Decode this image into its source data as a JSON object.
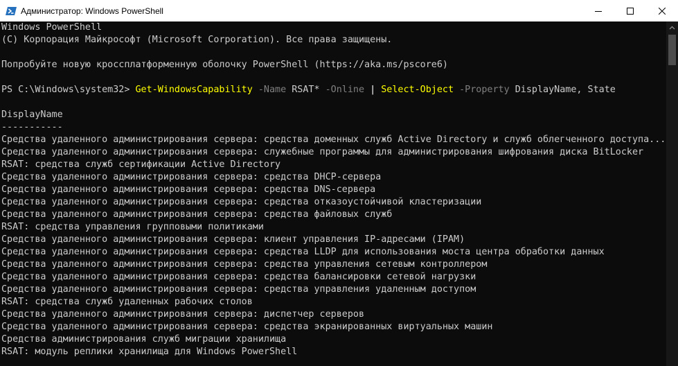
{
  "window": {
    "title": "Администратор: Windows PowerShell",
    "icons": {
      "app": "powershell-icon",
      "minimize": "minimize-icon",
      "maximize": "maximize-icon",
      "close": "close-icon"
    }
  },
  "console": {
    "banner": [
      "Windows PowerShell",
      "(C) Корпорация Майкрософт (Microsoft Corporation). Все права защищены.",
      "",
      "Попробуйте новую кроссплатформенную оболочку PowerShell (https://aka.ms/pscore6)",
      ""
    ],
    "command": {
      "prompt": "PS C:\\Windows\\system32> ",
      "cmdlet1": "Get-WindowsCapability",
      "param1": " -Name",
      "arg1": " RSAT*",
      "param2": " -Online",
      "pipe": " | ",
      "cmdlet2": "Select-Object",
      "param3": " -Property",
      "arg3": " DisplayName, State"
    },
    "output": [
      "",
      "DisplayName",
      "-----------",
      "Средства удаленного администрирования сервера: средства доменных служб Active Directory и служб облегченного доступа...",
      "Средства удаленного администрирования сервера: служебные программы для администрирования шифрования диска BitLocker",
      "RSAT: средства служб сертификации Active Directory",
      "Средства удаленного администрирования сервера: средства DHCP-сервера",
      "Средства удаленного администрирования сервера: средства DNS-сервера",
      "Средства удаленного администрирования сервера: средства отказоустойчивой кластеризации",
      "Средства удаленного администрирования сервера: средства файловых служб",
      "RSAT: средства управления групповыми политиками",
      "Средства удаленного администрирования сервера: клиент управления IP-адресами (IPAM)",
      "Средства удаленного администрирования сервера: средства LLDP для использования моста центра обработки данных",
      "Средства удаленного администрирования сервера: средства управления сетевым контроллером",
      "Средства удаленного администрирования сервера: средства балансировки сетевой нагрузки",
      "Средства удаленного администрирования сервера: средства управления удаленным доступом",
      "RSAT: средства служб удаленных рабочих столов",
      "Средства удаленного администрирования сервера: диспетчер серверов",
      "Средства удаленного администрирования сервера: средства экранированных виртуальных машин",
      "Средства администрирования служб миграции хранилища",
      "RSAT: модуль реплики хранилища для Windows PowerShell"
    ]
  },
  "colors": {
    "background": "#0c0c0c",
    "text": "#cccccc",
    "cmdlet": "#ffff00",
    "parameter": "#808080",
    "operator": "#ffffff",
    "titlebar": "#ffffff"
  }
}
